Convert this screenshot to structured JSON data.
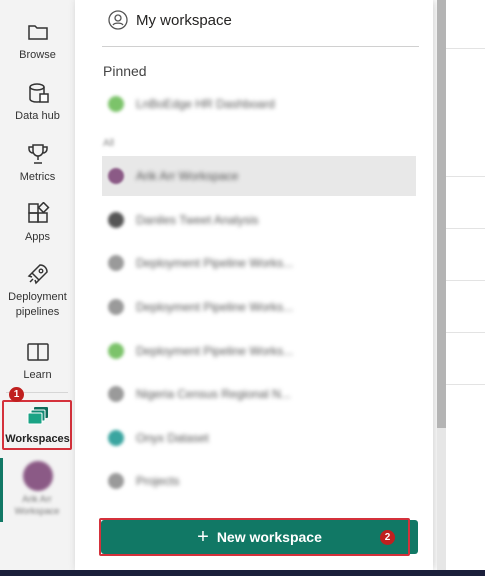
{
  "nav": {
    "items": [
      {
        "label": "Browse",
        "icon": "folder-icon"
      },
      {
        "label": "Data hub",
        "icon": "data-hub-icon"
      },
      {
        "label": "Metrics",
        "icon": "trophy-icon"
      },
      {
        "label": "Apps",
        "icon": "apps-icon"
      },
      {
        "label": "Deployment\npipelines",
        "icon": "rocket-icon"
      },
      {
        "label": "Learn",
        "icon": "book-icon"
      },
      {
        "label": "Workspaces",
        "icon": "workspaces-icon"
      }
    ],
    "workspaces_step": "1",
    "active_workspace_label": "Arik Arr Workspace"
  },
  "flyout": {
    "my_workspace": "My workspace",
    "pinned_title": "Pinned",
    "all_title": "All",
    "pinned": [
      {
        "name": "LnBoEdge HR Dashboard",
        "color": "#7cc36a"
      }
    ],
    "workspaces": [
      {
        "name": "Arik Arr Workspace",
        "color": "#8b5a86",
        "selected": true
      },
      {
        "name": "Daniles Tweet Analysis",
        "color": "#555555"
      },
      {
        "name": "Deployment Pipeline Works...",
        "color": "#9a9a9a"
      },
      {
        "name": "Deployment Pipeline Works...",
        "color": "#9a9a9a"
      },
      {
        "name": "Deployment Pipeline Works...",
        "color": "#7cc36a"
      },
      {
        "name": "Nigeria Census Regional N...",
        "color": "#9a9a9a"
      },
      {
        "name": "Onyx Dataset",
        "color": "#3aa5a0"
      },
      {
        "name": "Projects",
        "color": "#9a9a9a"
      }
    ],
    "new_workspace_label": "New workspace",
    "new_workspace_step": "2"
  },
  "colors": {
    "accent": "#117865",
    "highlight": "#d4313b"
  }
}
